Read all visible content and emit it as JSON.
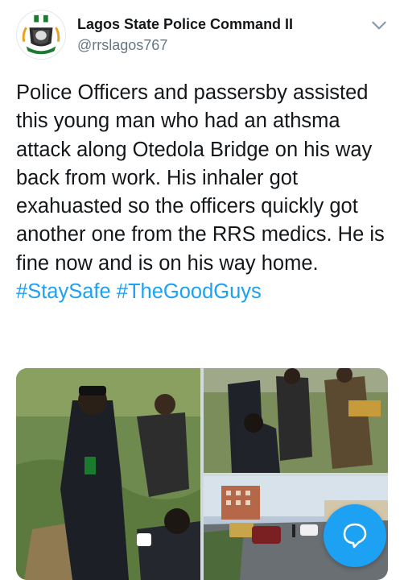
{
  "tweet": {
    "author": {
      "display_name": "Lagos State Police Command II",
      "handle": "@rrslagos767",
      "avatar_icon": "nigeria-police-crest"
    },
    "text": "Police Officers and passersby assisted this young man who had an athsma attack along Otedola Bridge on his way back from work. His inhaler got exahuasted so the officers quickly got another one from the RRS medics. He is fine now and is on his way home.",
    "hashtags": [
      "#StaySafe",
      "#TheGoodGuys"
    ],
    "media_count": 3
  },
  "icons": {
    "menu": "chevron-down-icon",
    "fab": "speech-bubble-icon"
  },
  "colors": {
    "link": "#1da1f2",
    "text": "#14171a",
    "secondary": "#657786",
    "fab": "#1da1f2"
  }
}
